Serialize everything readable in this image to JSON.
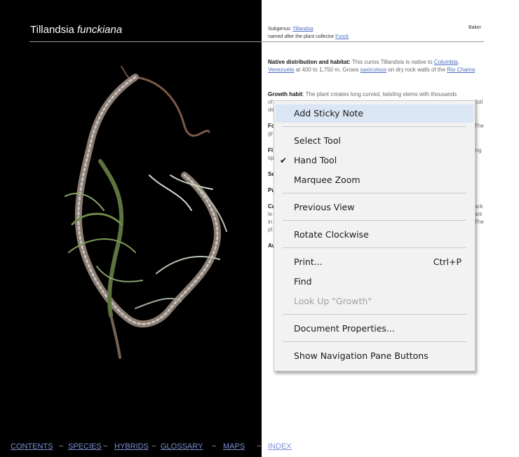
{
  "left": {
    "title_plain": "Tillandsia ",
    "title_italic": "funckiana"
  },
  "meta": {
    "subgenus_label": "Subgenus: ",
    "subgenus_link": "Tillandsia",
    "author": "Baker",
    "named_prefix": "named after the plant collector ",
    "named_link": "Funck"
  },
  "paragraphs": {
    "native": {
      "label": "Native distribution and habitat:",
      "t1": " This curios Tillandsia is native to ",
      "l1": "Columbia",
      "t2": ", ",
      "l2": "Venezuela",
      "t3": " at 400 to 1,750 m. Grows ",
      "l3": "saxicolous",
      "t4": " on dry rock walls of the ",
      "l4": "Rio Chama"
    },
    "growth": {
      "label": "Growth habit",
      "t1": ": The plant creates long curved, twisting stems with thousands",
      "frag2": "of",
      "frag2r": "foil",
      "frag3": "de"
    },
    "fo": {
      "label": "Fo",
      "right": "The"
    },
    "fo2": {
      "left": "gr"
    },
    "fl": {
      "label": "Fl",
      "right": "ing"
    },
    "fl2": {
      "left": "tip"
    },
    "se": {
      "label": "Se"
    },
    "pu": {
      "label": "Pu"
    },
    "cu": {
      "label": "Cu",
      "right": "ack"
    },
    "cu2": {
      "left": "le",
      "right": "ant"
    },
    "cu3": {
      "left": "in",
      "right": "The"
    },
    "cu4": {
      "left": "pl"
    },
    "av": {
      "label": "Av"
    }
  },
  "footer": {
    "links": [
      "CONTENTS",
      "SPECIES",
      "HYBRIDS",
      "GLOSSARY",
      "MAPS",
      "INDEX"
    ],
    "sep": "~"
  },
  "context_menu": {
    "items": [
      {
        "label": "Add Sticky Note",
        "highlighted": true
      },
      {
        "label": "Select Tool"
      },
      {
        "label": "Hand Tool",
        "checked": true
      },
      {
        "label": "Marquee Zoom"
      },
      {
        "label": "Previous View"
      },
      {
        "label": "Rotate Clockwise"
      },
      {
        "label": "Print...",
        "shortcut": "Ctrl+P"
      },
      {
        "label": "Find"
      },
      {
        "label": "Look Up \"Growth\"",
        "disabled": true
      },
      {
        "label": "Document Properties..."
      },
      {
        "label": "Show Navigation Pane Buttons"
      }
    ],
    "check_glyph": "✔"
  },
  "colors": {
    "menu_highlight": "#dbe6f4",
    "link": "#4a6fc0",
    "footer_link": "#7b8fd1"
  }
}
